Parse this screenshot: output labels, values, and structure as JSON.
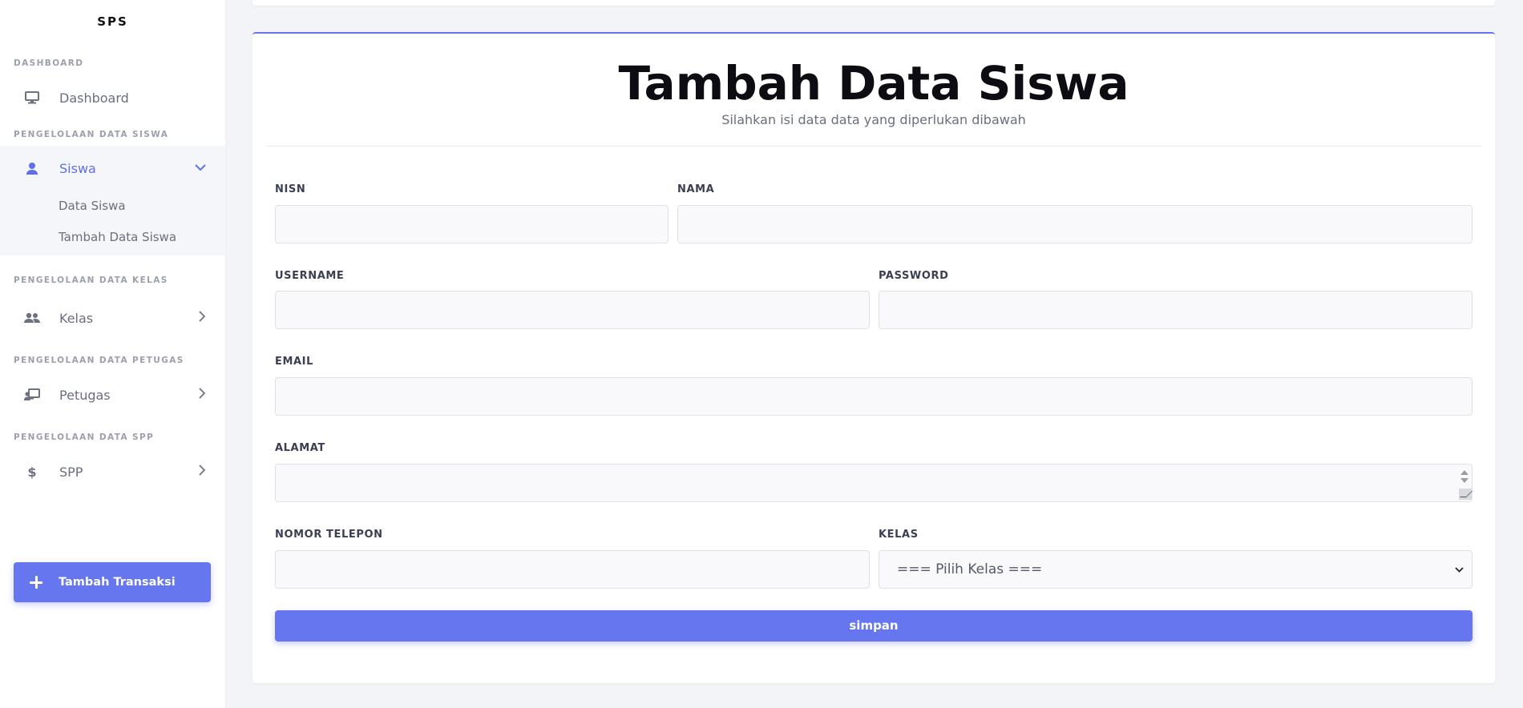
{
  "brand": "SPS",
  "sidebar": {
    "sections": [
      {
        "label": "DASHBOARD"
      },
      {
        "label": "PENGELOLAAN DATA SISWA"
      },
      {
        "label": "PENGELOLAAN DATA KELAS"
      },
      {
        "label": "PENGELOLAAN DATA PETUGAS"
      },
      {
        "label": "PENGELOLAAN DATA SPP"
      }
    ],
    "items": {
      "dashboard": {
        "label": "Dashboard",
        "icon": "monitor-icon"
      },
      "siswa": {
        "label": "Siswa",
        "icon": "user-icon",
        "active": true
      },
      "kelas": {
        "label": "Kelas",
        "icon": "users-icon"
      },
      "petugas": {
        "label": "Petugas",
        "icon": "teacher-icon"
      },
      "spp": {
        "label": "SPP",
        "icon": "dollar-icon"
      }
    },
    "submenu": [
      "Data Siswa",
      "Tambah Data Siswa"
    ],
    "cta_label": "Tambah Transaksi"
  },
  "main": {
    "title": "Tambah Data Siswa",
    "subtitle": "Silahkan isi data data yang diperlukan dibawah",
    "fields": {
      "nisn": {
        "label": "NISN",
        "value": ""
      },
      "nama": {
        "label": "NAMA",
        "value": ""
      },
      "username": {
        "label": "USERNAME",
        "value": ""
      },
      "password": {
        "label": "PASSWORD",
        "value": ""
      },
      "email": {
        "label": "EMAIL",
        "value": ""
      },
      "alamat": {
        "label": "ALAMAT",
        "value": ""
      },
      "nomor_telepon": {
        "label": "NOMOR TELEPON",
        "value": ""
      },
      "kelas": {
        "label": "KELAS",
        "selected": "=== Pilih Kelas ==="
      }
    },
    "submit_label": "simpan"
  },
  "colors": {
    "accent": "#6676ee",
    "active_text": "#5f6fe8",
    "background": "#f3f4f8"
  }
}
